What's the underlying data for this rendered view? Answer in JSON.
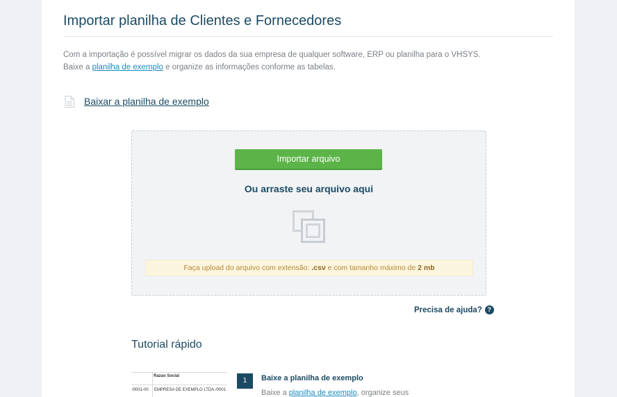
{
  "page": {
    "title": "Importar planilha de Clientes e Fornecedores",
    "intro_line1": "Com a importação é possível migrar os dados da sua empresa de qualquer software, ERP ou planilha para o VHSYS.",
    "intro_line2_prefix": "Baixe a ",
    "intro_line2_link": "planilha de exemplo",
    "intro_line2_suffix": " e organize as informações conforme as tabelas."
  },
  "download": {
    "icon": "spreadsheet-file-icon",
    "label": "Baixar a planilha de exemplo"
  },
  "dropzone": {
    "button_label": "Importar arquivo",
    "drag_text": "Ou arraste seu arquivo aqui",
    "icon": "drop-file-icon",
    "notice_prefix": "Faça upload do arquivo com extensão: ",
    "notice_ext": ".csv",
    "notice_middle": " e com tamanho máximo de ",
    "notice_size": "2 mb"
  },
  "help": {
    "label": "Precisa de ajuda?",
    "icon_glyph": "?"
  },
  "tutorial": {
    "title": "Tutorial rápido",
    "preview": {
      "header": "Razao Social",
      "row_code": "/0001-00",
      "row_name": "EMPRESA DE EXEMPLO LTDA",
      "row_code2": "/0001"
    },
    "steps": [
      {
        "number": "1",
        "title": "Baixe a planilha de exemplo",
        "desc_prefix": "Baixe a ",
        "desc_link": "planilha de exemplo",
        "desc_suffix": ", organize seus"
      }
    ]
  },
  "colors": {
    "primary": "#1b4a64",
    "button_green": "#5cb449",
    "link": "#1b8bbd",
    "notice_bg": "#fbf5dd"
  }
}
